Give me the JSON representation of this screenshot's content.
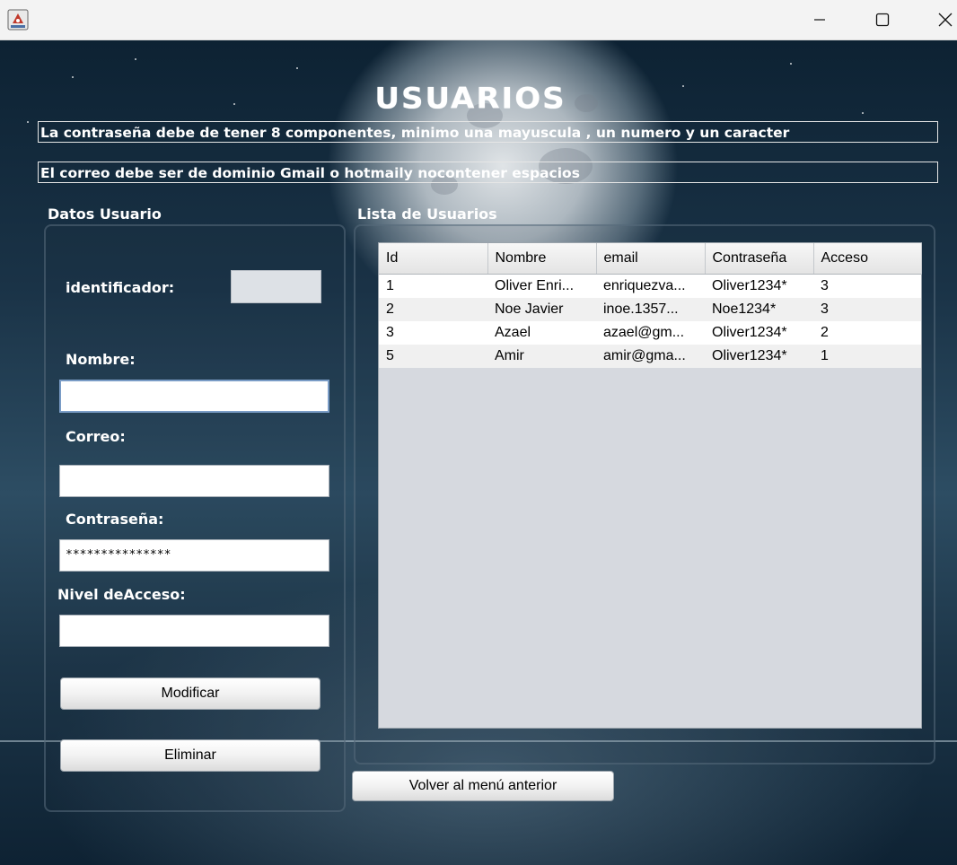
{
  "window": {
    "icon": "java-app-icon"
  },
  "heading": "USUARIOS",
  "notices": [
    "La contraseña debe de tener 8 componentes, minimo una mayuscula , un numero y un caracter",
    "El correo debe ser de dominio Gmail o hotmaily nocontener espacios"
  ],
  "form": {
    "section_label": "Datos Usuario",
    "id_label": "identificador:",
    "id_value": "",
    "name_label": "Nombre:",
    "name_value": "",
    "email_label": "Correo:",
    "email_value": "",
    "password_label": "Contraseña:",
    "password_value": "***************",
    "access_label": "Nivel deAcceso:",
    "access_value": "",
    "modify_button": "Modificar",
    "delete_button": "Eliminar"
  },
  "list": {
    "section_label": "Lista de Usuarios",
    "columns": [
      "Id",
      "Nombre",
      "email",
      "Contraseña",
      "Acceso"
    ],
    "rows": [
      [
        "1",
        "Oliver Enri...",
        "enriquezva...",
        "Oliver1234*",
        "3"
      ],
      [
        "2",
        "Noe Javier",
        "inoe.1357...",
        "Noe1234*",
        "3"
      ],
      [
        "3",
        "Azael",
        "azael@gm...",
        "Oliver1234*",
        "2"
      ],
      [
        "5",
        "Amir",
        "amir@gma...",
        "Oliver1234*",
        "1"
      ]
    ]
  },
  "back_button": "Volver al menú anterior"
}
